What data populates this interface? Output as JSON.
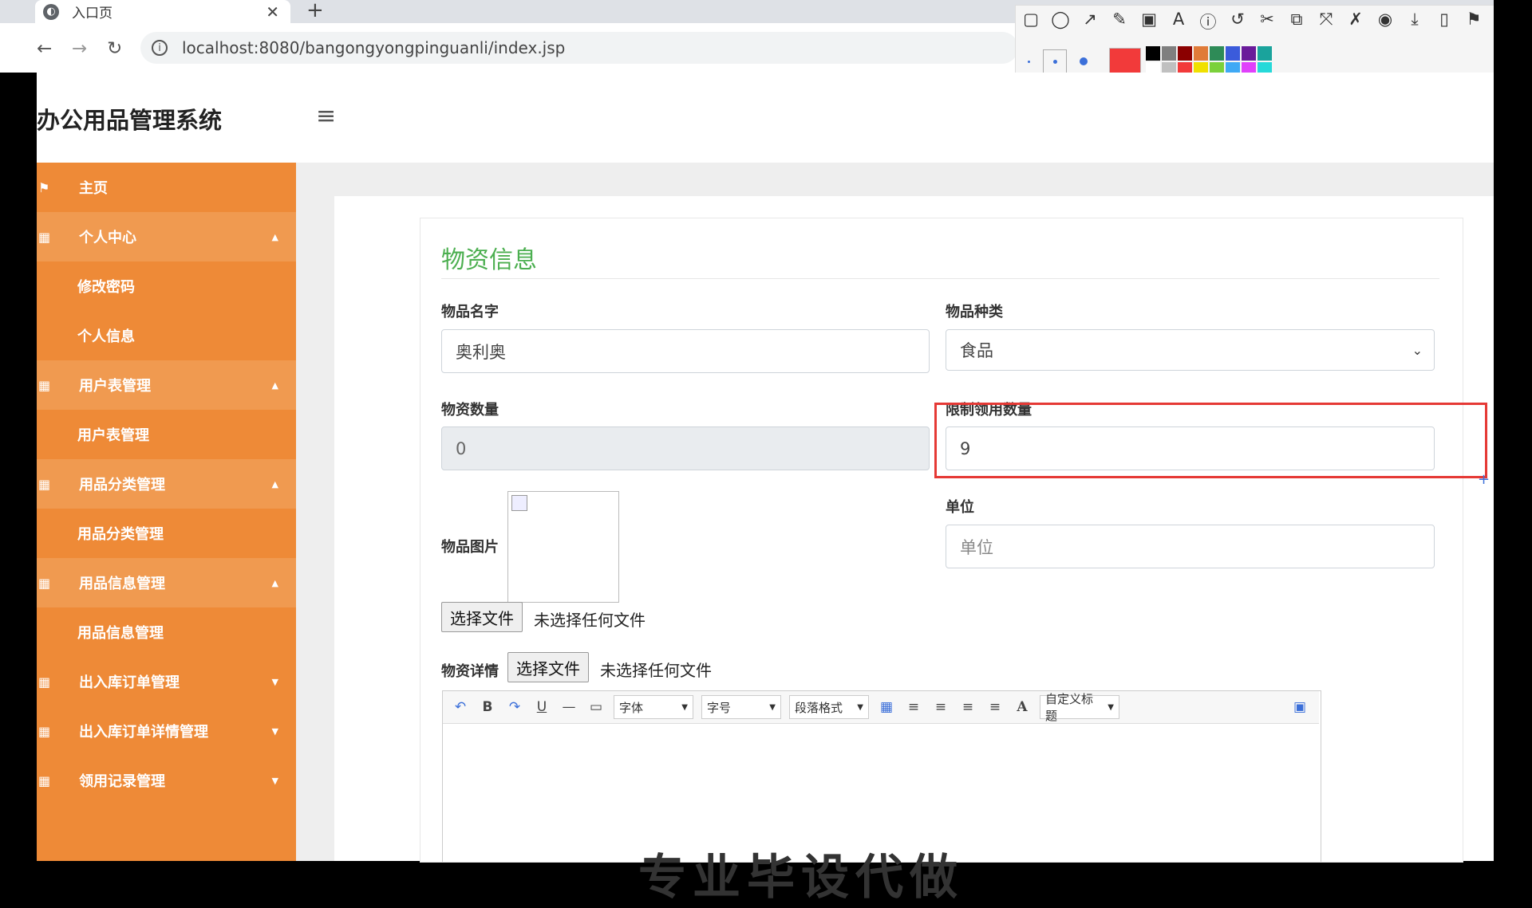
{
  "browser": {
    "tab_title": "入口页",
    "tab_close": "✕",
    "new_tab": "+",
    "url": "localhost:8080/bangongyongpinguanli/index.jsp",
    "icons": [
      "back-arrow-icon",
      "forward-arrow-icon",
      "reload-icon",
      "info-icon"
    ]
  },
  "annotation": {
    "tools": [
      "▢",
      "◯",
      "↗",
      "✎",
      "▣",
      "A",
      "ⓘ",
      "↺",
      "✂",
      "⧉",
      "⤧",
      "✗",
      "◉",
      "⤓",
      "▯",
      "⚑"
    ],
    "selected_color": "#f23a3a",
    "palette": [
      "#000000",
      "#7f7f7f",
      "#8b0000",
      "#e07b39",
      "#2e8b57",
      "#3b5bdb",
      "#6a1b9a",
      "#1aa39c",
      "#ffffff",
      "#c0c0c0",
      "#f23a3a",
      "#f0e000",
      "#7bd13b",
      "#3fa9f5",
      "#e040fb",
      "#26d9d9"
    ]
  },
  "app": {
    "title": "办公用品管理系统",
    "menu_icon": "≡"
  },
  "sidebar": {
    "items": [
      {
        "label": "主页",
        "icon": "⚑",
        "type": "home",
        "caret": ""
      },
      {
        "label": "个人中心",
        "icon": "▦",
        "type": "group",
        "caret": "▲"
      },
      {
        "label": "修改密码",
        "icon": "",
        "type": "sub",
        "caret": ""
      },
      {
        "label": "个人信息",
        "icon": "",
        "type": "sub",
        "caret": ""
      },
      {
        "label": "用户表管理",
        "icon": "▦",
        "type": "group",
        "caret": "▲"
      },
      {
        "label": "用户表管理",
        "icon": "",
        "type": "sub",
        "caret": ""
      },
      {
        "label": "用品分类管理",
        "icon": "▦",
        "type": "group",
        "caret": "▲"
      },
      {
        "label": "用品分类管理",
        "icon": "",
        "type": "sub",
        "caret": ""
      },
      {
        "label": "用品信息管理",
        "icon": "▦",
        "type": "group",
        "caret": "▲"
      },
      {
        "label": "用品信息管理",
        "icon": "",
        "type": "sub",
        "caret": ""
      },
      {
        "label": "出入库订单管理",
        "icon": "▦",
        "type": "collapsed",
        "caret": "▼"
      },
      {
        "label": "出入库订单详情管理",
        "icon": "▦",
        "type": "collapsed",
        "caret": "▼"
      },
      {
        "label": "领用记录管理",
        "icon": "▦",
        "type": "collapsed",
        "caret": "▼"
      }
    ]
  },
  "form": {
    "title": "物资信息",
    "name_label": "物品名字",
    "name_value": "奥利奥",
    "category_label": "物品种类",
    "category_value": "食品",
    "quantity_label": "物资数量",
    "quantity_value": "0",
    "limit_label": "限制领用数量",
    "limit_value": "9",
    "image_label": "物品图片",
    "unit_label": "单位",
    "unit_placeholder": "单位",
    "file_button": "选择文件",
    "no_file": "未选择任何文件",
    "detail_label": "物资详情",
    "detail_file_button": "选择文件",
    "detail_no_file": "未选择任何文件"
  },
  "editor": {
    "undo": "↶",
    "bold": "B",
    "redo": "↷",
    "underline": "U",
    "hr": "—",
    "page": "▭",
    "font": "字体",
    "size": "字号",
    "paragraph": "段落格式",
    "align_icons": [
      "▦",
      "≡",
      "≡",
      "≡",
      "≡"
    ],
    "font_color": "A",
    "custom_title": "自定义标题",
    "fullscreen": "▣",
    "body_text": "专业毕设代做"
  }
}
